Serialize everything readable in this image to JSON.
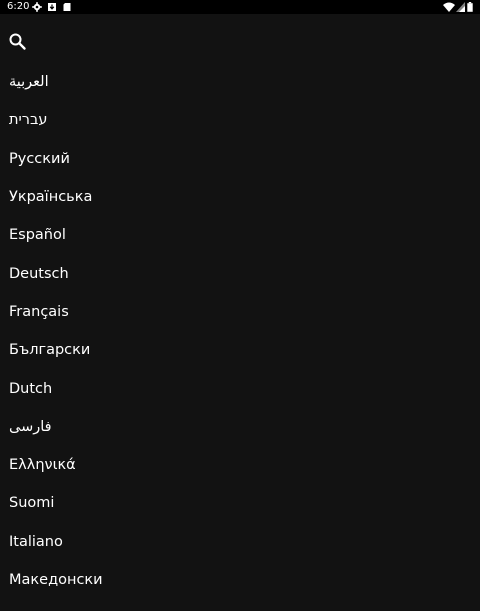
{
  "status_bar": {
    "time": "6:20",
    "icons_left": [
      "gear-icon",
      "download-icon",
      "sd-card-icon"
    ],
    "icons_right": [
      "wifi-icon",
      "signal-icon",
      "battery-icon"
    ]
  },
  "search": {
    "icon": "search-icon"
  },
  "languages": [
    "العربية",
    "עברית",
    "Русский",
    "Українська",
    "Español",
    "Deutsch",
    "Français",
    "Български",
    "Dutch",
    "فارسی",
    "Ελληνικά",
    "Suomi",
    "Italiano",
    "Македонски"
  ],
  "colors": {
    "background": "#121212",
    "status_bar": "#000000",
    "text": "#ffffff"
  }
}
